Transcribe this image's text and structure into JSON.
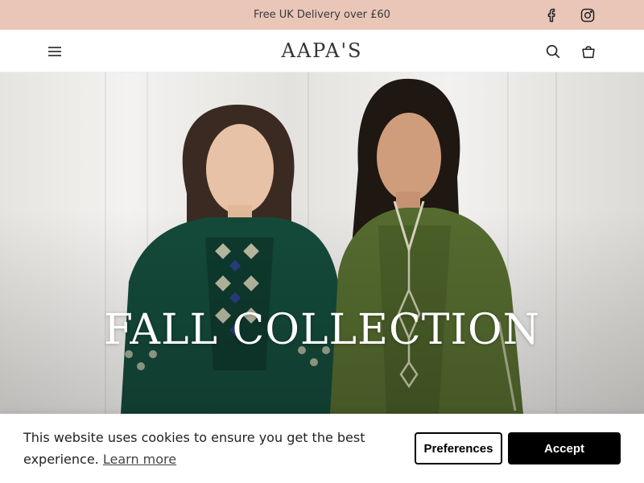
{
  "announcement": {
    "text": "Free UK Delivery over £60",
    "background": "#e9c6b8"
  },
  "social": {
    "facebook_icon": "facebook-icon",
    "instagram_icon": "instagram-icon"
  },
  "header": {
    "logo": "AAPA'S",
    "menu_icon": "hamburger-menu-icon",
    "search_icon": "search-icon",
    "cart_icon": "shopping-bag-icon"
  },
  "hero": {
    "title": "FALL COLLECTION",
    "image": "two-models-in-embroidered-green-kaftans"
  },
  "cookie_banner": {
    "message": "This website uses cookies to ensure you get the best experience.",
    "learn_more": "Learn more",
    "preferences_label": "Preferences",
    "accept_label": "Accept"
  }
}
